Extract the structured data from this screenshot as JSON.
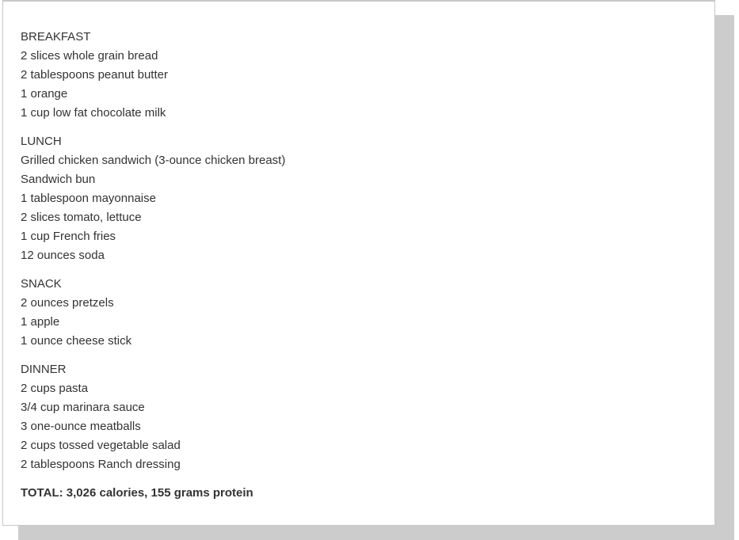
{
  "sections": [
    {
      "heading": "BREAKFAST",
      "items": [
        "2 slices whole grain bread",
        "2 tablespoons peanut butter",
        "1 orange",
        "1 cup low fat chocolate milk"
      ]
    },
    {
      "heading": "LUNCH",
      "items": [
        "Grilled chicken sandwich (3-ounce chicken breast)",
        "Sandwich bun",
        "1 tablespoon mayonnaise",
        "2 slices tomato, lettuce",
        "1 cup French fries",
        "12 ounces soda"
      ]
    },
    {
      "heading": "SNACK",
      "items": [
        "2 ounces pretzels",
        "1 apple",
        "1 ounce cheese stick"
      ]
    },
    {
      "heading": "DINNER",
      "items": [
        "2 cups pasta",
        "3/4 cup marinara sauce",
        "3 one-ounce meatballs",
        "2 cups tossed vegetable salad",
        "2 tablespoons Ranch dressing"
      ]
    }
  ],
  "total": "TOTAL: 3,026 calories, 155 grams protein"
}
